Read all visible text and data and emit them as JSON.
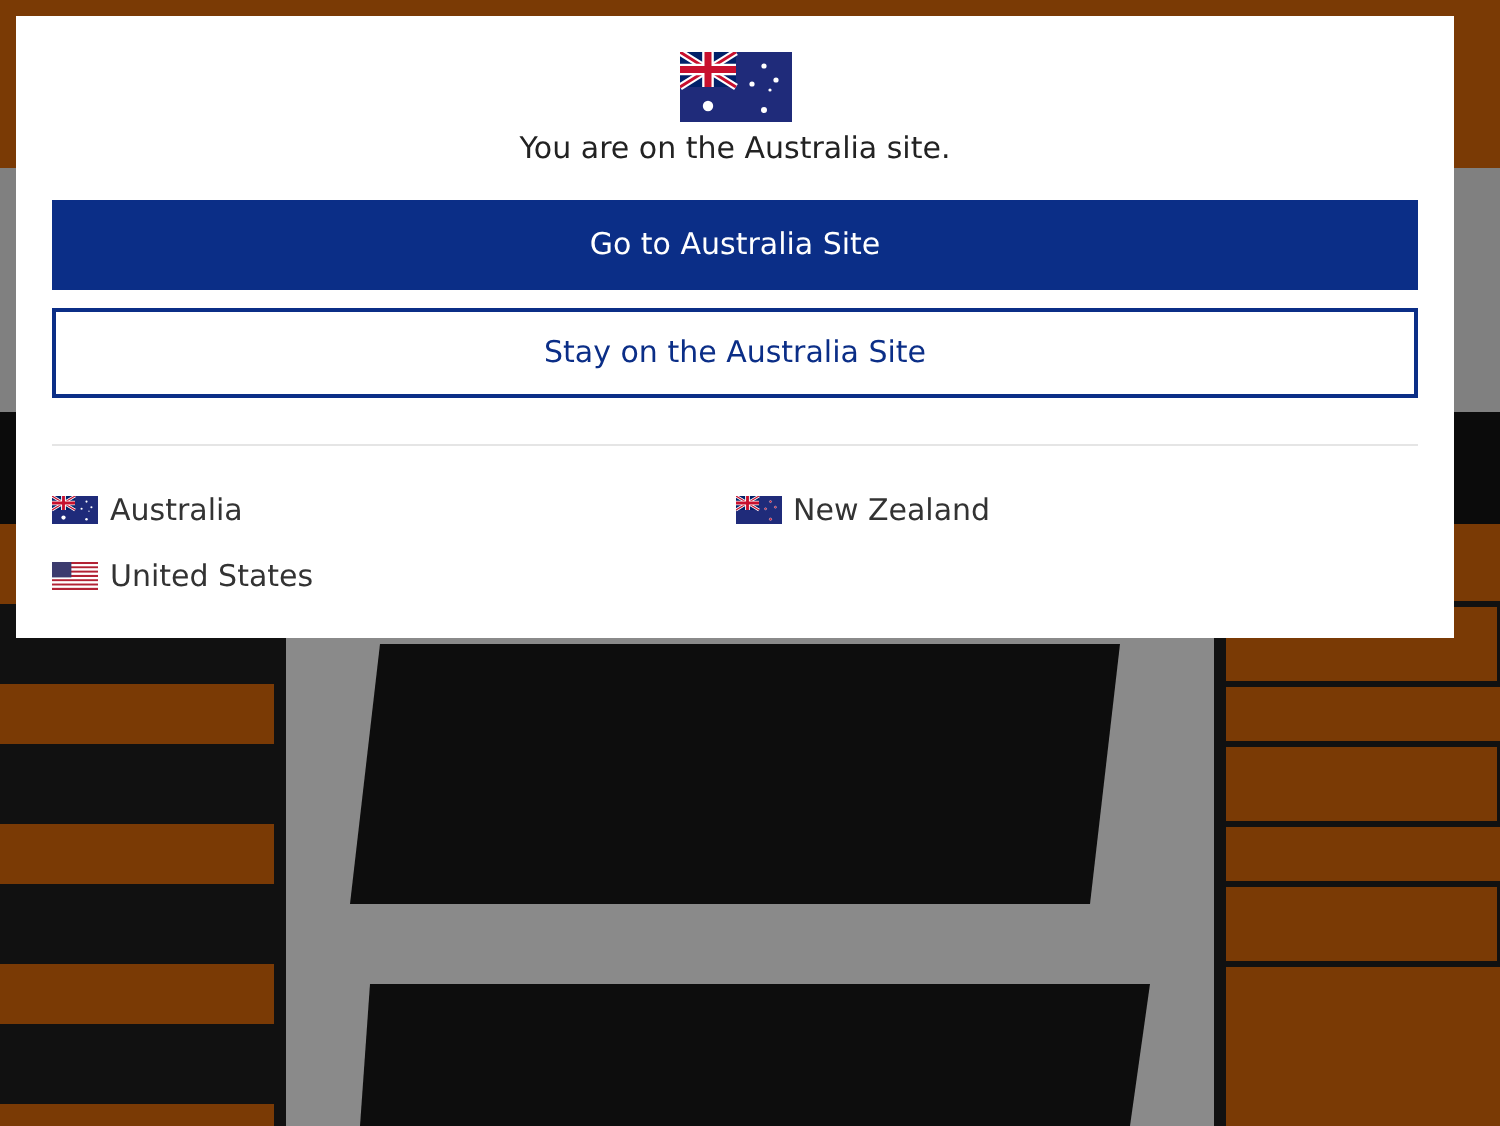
{
  "modal": {
    "kind": "au",
    "message": "You are on the Australia site.",
    "primary_button": "Go to Australia Site",
    "secondary_button": "Stay on the Australia Site",
    "countries": [
      {
        "kind": "au",
        "name": "Australia"
      },
      {
        "kind": "nz",
        "name": "New Zealand"
      },
      {
        "kind": "us",
        "name": "United States"
      }
    ]
  }
}
